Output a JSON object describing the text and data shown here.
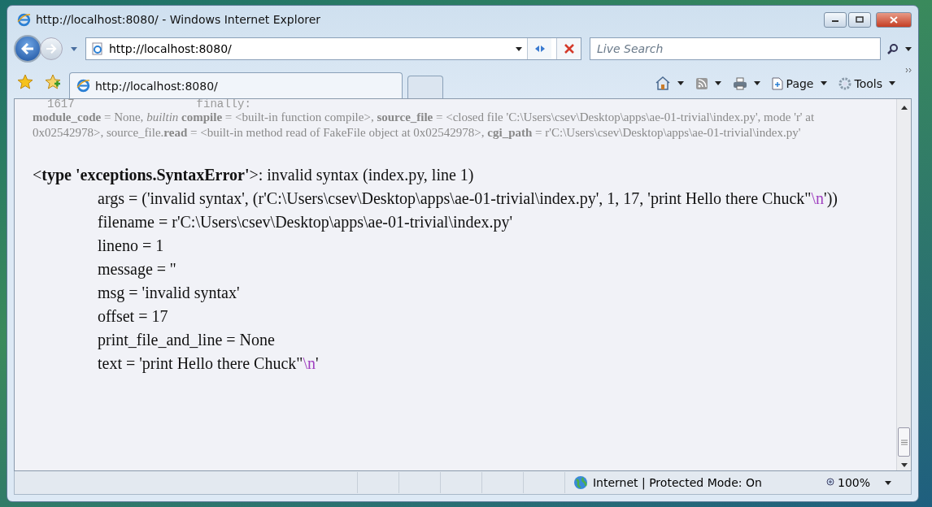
{
  "window": {
    "title": "http://localhost:8080/ - Windows Internet Explorer"
  },
  "nav": {
    "address": "http://localhost:8080/",
    "search_placeholder": "Live Search"
  },
  "tabs": [
    {
      "label": "http://localhost:8080/",
      "selected": true
    },
    {
      "selected": false
    }
  ],
  "commands": [
    {
      "kind": "home"
    },
    {
      "kind": "feeds"
    },
    {
      "kind": "print"
    },
    {
      "kind": "page",
      "label": "Page"
    },
    {
      "kind": "tools",
      "label": "Tools"
    }
  ],
  "content": {
    "cut_line": [
      "1617",
      "finally:"
    ],
    "locals_text": "**module_code** = None, *builtin* **compile** = <built-in function compile>, **source_file** = <closed file 'C:\\Users\\csev\\Desktop\\apps\\ae-01-trivial\\index.py', mode 'r' at 0x02542978>, source_file.**read** = <built-in method read of FakeFile object at 0x02542978>, **cgi_path** = r'C:\\Users\\csev\\Desktop\\apps\\ae-01-trivial\\index.py'",
    "error_lines": [
      [
        {
          "kind": "plain",
          "text": "<"
        },
        {
          "kind": "bold",
          "text": "type 'exceptions.SyntaxError'"
        },
        {
          "kind": "plain",
          "text": ">: invalid syntax (index.py, line 1)"
        }
      ],
      [
        {
          "kind": "plain",
          "text": "args = ('invalid syntax', (r'C:\\Users\\csev\\Desktop\\apps\\ae-01-trivial\\index.py', 1, 17, 'print Hello there Chuck\""
        },
        {
          "kind": "escape",
          "text": "\\n"
        },
        {
          "kind": "plain",
          "text": "'))"
        }
      ],
      [
        {
          "kind": "plain",
          "text": "filename = r'C:\\Users\\csev\\Desktop\\apps\\ae-01-trivial\\index.py'"
        }
      ],
      [
        {
          "kind": "plain",
          "text": "lineno = 1"
        }
      ],
      [
        {
          "kind": "plain",
          "text": "message = ''"
        }
      ],
      [
        {
          "kind": "plain",
          "text": "msg = 'invalid syntax'"
        }
      ],
      [
        {
          "kind": "plain",
          "text": "offset = 17"
        }
      ],
      [
        {
          "kind": "plain",
          "text": "print_file_and_line = None"
        }
      ],
      [
        {
          "kind": "plain",
          "text": "text = 'print Hello there Chuck\""
        },
        {
          "kind": "escape",
          "text": "\\n"
        },
        {
          "kind": "plain",
          "text": "'"
        }
      ]
    ]
  },
  "status_bar": {
    "zone": "Internet | Protected Mode: On",
    "zoom": "100%"
  }
}
